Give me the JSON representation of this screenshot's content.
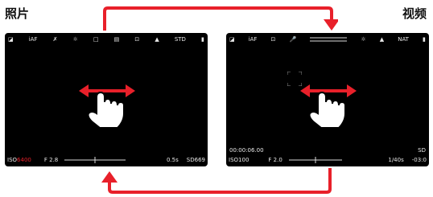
{
  "headings": {
    "photo": "照片",
    "video": "视频"
  },
  "colors": {
    "accent": "#e8202a",
    "screen_bg": "#000000",
    "page_bg": "#ffffff"
  },
  "photo_screen": {
    "top_icons": [
      "mode-P-icon",
      "iAF-icon",
      "flash-off-icon",
      "white-balance-icon",
      "metering-icon",
      "drive-mode-icon",
      "focus-area-icon",
      "stabilization-icon"
    ],
    "iaf_label": "iAF",
    "std_label": "STD",
    "iso_label": "ISO",
    "iso_value": "6400",
    "aperture": "F 2.8",
    "shutter": "0.5s",
    "sd_label": "SD",
    "shots_left": "669"
  },
  "video_screen": {
    "iaf_label": "iAF",
    "nat_label": "NAT",
    "timecode": "00:00:06.00",
    "iso_label": "ISO",
    "iso_value": "100",
    "aperture": "F 2.0",
    "shutter": "1/40s",
    "sd_label": "SD",
    "remaining": "-03:0"
  },
  "gesture": "swipe-horizontal-icon"
}
